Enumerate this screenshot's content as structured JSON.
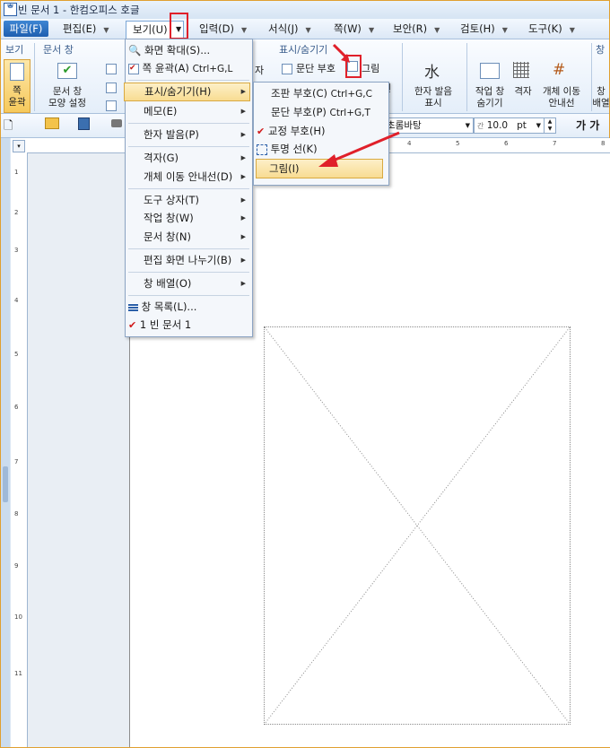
{
  "window": {
    "title": "빈 문서 1 - 한컴오피스 호글",
    "icon": "hwp-app-icon"
  },
  "menubar": {
    "items": [
      {
        "label": "파일(F)"
      },
      {
        "label": "편집(E)"
      },
      {
        "label": "보기(U)"
      },
      {
        "label": "입력(D)"
      },
      {
        "label": "서식(J)"
      },
      {
        "label": "쪽(W)"
      },
      {
        "label": "보안(R)"
      },
      {
        "label": "검토(H)"
      },
      {
        "label": "도구(K)"
      }
    ]
  },
  "ribbon": {
    "groups": {
      "view": "보기",
      "doc_window": "문서 창",
      "show_hide": "표시/숨기기",
      "window": "창"
    },
    "buttons": {
      "page_outline": "쪽\n윤곽",
      "doc_window_shape": "문서 창\n모양 설정",
      "hanja_pron": "한자 발음\n표시",
      "task_window": "작업 창\n숨기기",
      "grid": "격자",
      "object_guide": "개체 이동\n안내선",
      "window_arrange": "창\n배열"
    },
    "checks": {
      "para_mark": "문단 부호",
      "picture": "그림"
    },
    "partial_labels": {
      "ja": "자",
      "seon": "선"
    }
  },
  "toolbar": {
    "font_name": "초롬바탕",
    "font_size": "10.0",
    "unit": "pt",
    "font_size_prefix": "간"
  },
  "view_menu": {
    "items": [
      {
        "label": "화면 확대(S)...",
        "icon": "zoom-icon"
      },
      {
        "label": "쪽 윤곽(A)",
        "shortcut": "Ctrl+G,L",
        "icon": "page-outline-icon"
      },
      {
        "label": "표시/숨기기(H)",
        "submenu": true
      },
      {
        "label": "메모(E)",
        "submenu": true
      },
      {
        "label": "한자 발음(P)",
        "submenu": true
      },
      {
        "label": "격자(G)",
        "submenu": true
      },
      {
        "label": "개체 이동 안내선(D)",
        "submenu": true
      },
      {
        "label": "도구 상자(T)",
        "submenu": true
      },
      {
        "label": "작업 창(W)",
        "submenu": true
      },
      {
        "label": "문서 창(N)",
        "submenu": true
      },
      {
        "label": "편집 화면 나누기(B)",
        "submenu": true
      },
      {
        "label": "창 배열(O)",
        "submenu": true
      },
      {
        "label": "창 목록(L)...",
        "icon": "window-list-icon"
      },
      {
        "label": "1 빈 문서 1",
        "checked": true
      }
    ]
  },
  "showhide_submenu": {
    "items": [
      {
        "label": "조판 부호(C)",
        "shortcut": "Ctrl+G,C"
      },
      {
        "label": "문단 부호(P)",
        "shortcut": "Ctrl+G,T"
      },
      {
        "label": "교정 부호(H)",
        "checked": true
      },
      {
        "label": "투명 선(K)",
        "icon": "transparent-line-icon"
      },
      {
        "label": "그림(I)"
      }
    ]
  },
  "ruler": {
    "h_numbers": [
      "4",
      "5",
      "6",
      "7",
      "8"
    ],
    "v_numbers": [
      "1",
      "2",
      "3",
      "4",
      "5",
      "6",
      "7",
      "8",
      "9",
      "10",
      "11"
    ]
  },
  "colors": {
    "accent": "#1f5fb0",
    "highlight_red": "#e0202a",
    "menu_hover": "#f8dc92"
  }
}
